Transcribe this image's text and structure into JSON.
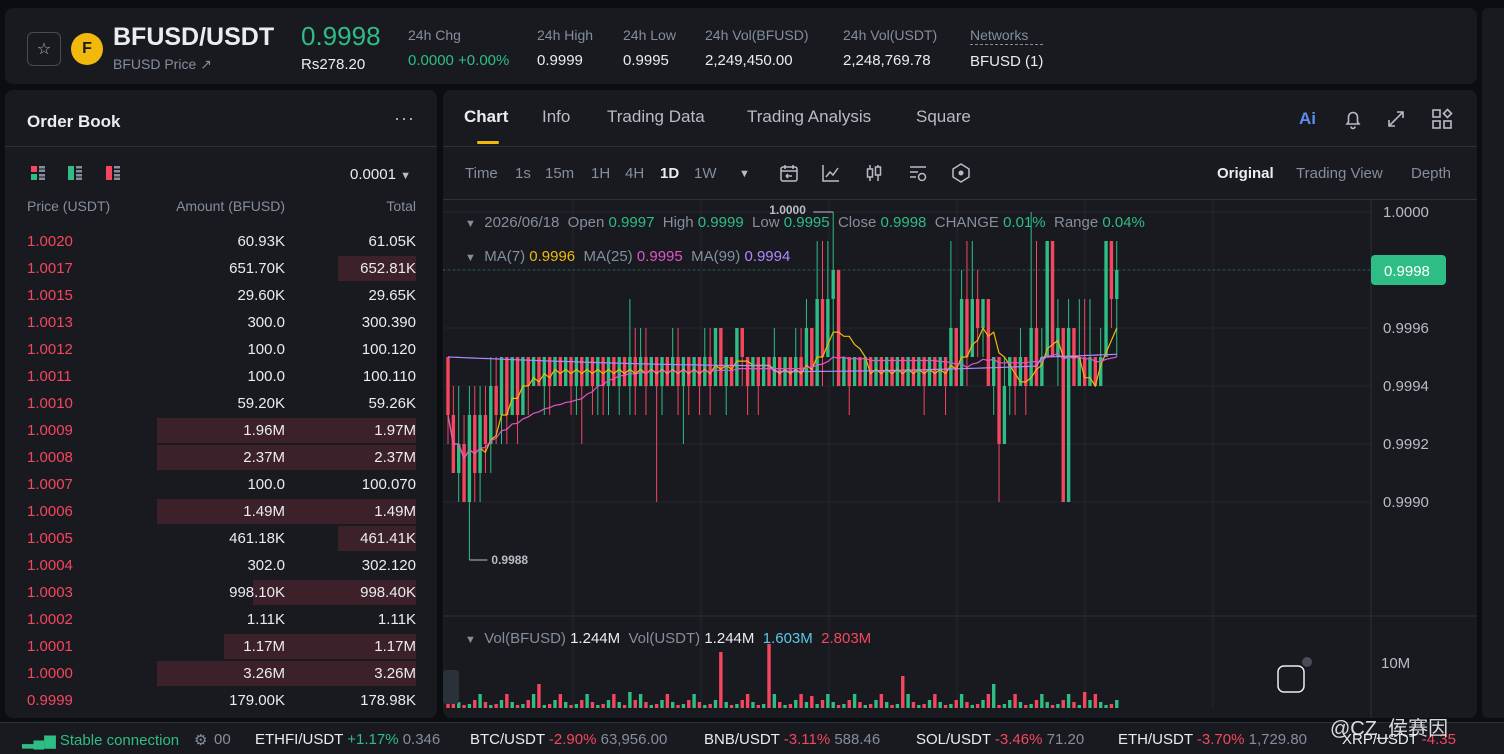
{
  "header": {
    "pair": "BFUSD/USDT",
    "sub": "BFUSD Price ↗",
    "last_price": "0.9998",
    "last_price_local": "Rs278.20",
    "stats": [
      {
        "label": "24h Chg",
        "value": "0.0000 +0.00%",
        "color": "#2ebd85"
      },
      {
        "label": "24h High",
        "value": "0.9999"
      },
      {
        "label": "24h Low",
        "value": "0.9995"
      },
      {
        "label": "24h Vol(BFUSD)",
        "value": "2,249,450.00"
      },
      {
        "label": "24h Vol(USDT)",
        "value": "2,248,769.78"
      },
      {
        "label": "Networks",
        "value": "BFUSD (1)"
      }
    ]
  },
  "orderbook": {
    "title": "Order Book",
    "precision": "0.0001",
    "col_price": "Price (USDT)",
    "col_amount": "Amount (BFUSD)",
    "col_total": "Total",
    "asks": [
      {
        "price": "1.0020",
        "amount": "60.93K",
        "total": "61.05K",
        "depth": 0.0
      },
      {
        "price": "1.0017",
        "amount": "651.70K",
        "total": "652.81K",
        "depth": 0.3
      },
      {
        "price": "1.0015",
        "amount": "29.60K",
        "total": "29.65K",
        "depth": 0.0
      },
      {
        "price": "1.0013",
        "amount": "300.0",
        "total": "300.390",
        "depth": 0.0
      },
      {
        "price": "1.0012",
        "amount": "100.0",
        "total": "100.120",
        "depth": 0.0
      },
      {
        "price": "1.0011",
        "amount": "100.0",
        "total": "100.110",
        "depth": 0.0
      },
      {
        "price": "1.0010",
        "amount": "59.20K",
        "total": "59.26K",
        "depth": 0.0
      },
      {
        "price": "1.0009",
        "amount": "1.96M",
        "total": "1.97M",
        "depth": 1.0
      },
      {
        "price": "1.0008",
        "amount": "2.37M",
        "total": "2.37M",
        "depth": 1.0
      },
      {
        "price": "1.0007",
        "amount": "100.0",
        "total": "100.070",
        "depth": 0.0
      },
      {
        "price": "1.0006",
        "amount": "1.49M",
        "total": "1.49M",
        "depth": 1.0
      },
      {
        "price": "1.0005",
        "amount": "461.18K",
        "total": "461.41K",
        "depth": 0.3
      },
      {
        "price": "1.0004",
        "amount": "302.0",
        "total": "302.120",
        "depth": 0.0
      },
      {
        "price": "1.0003",
        "amount": "998.10K",
        "total": "998.40K",
        "depth": 0.63
      },
      {
        "price": "1.0002",
        "amount": "1.11K",
        "total": "1.11K",
        "depth": 0.0
      },
      {
        "price": "1.0001",
        "amount": "1.17M",
        "total": "1.17M",
        "depth": 0.74
      },
      {
        "price": "1.0000",
        "amount": "3.26M",
        "total": "3.26M",
        "depth": 1.0
      },
      {
        "price": "0.9999",
        "amount": "179.00K",
        "total": "178.98K",
        "depth": 0.0
      }
    ]
  },
  "chart_tabs": [
    "Chart",
    "Info",
    "Trading Data",
    "Trading Analysis",
    "Square"
  ],
  "ai_label": "Ai",
  "intervals": [
    "Time",
    "1s",
    "15m",
    "1H",
    "4H",
    "1D",
    "1W"
  ],
  "active_interval": "1D",
  "views": [
    "Original",
    "Trading View",
    "Depth"
  ],
  "ohlc": {
    "date": "2026/06/18",
    "open_label": "Open",
    "open": "0.9997",
    "high_label": "High",
    "high": "0.9999",
    "low_label": "Low",
    "low": "0.9995",
    "close_label": "Close",
    "close": "0.9998",
    "change_label": "CHANGE",
    "change": "0.01%",
    "range_label": "Range",
    "range": "0.04%"
  },
  "ma": {
    "ma7_label": "MA(7)",
    "ma7": "0.9996",
    "ma25_label": "MA(25)",
    "ma25": "0.9995",
    "ma99_label": "MA(99)",
    "ma99": "0.9994"
  },
  "vol": {
    "label1": "Vol(BFUSD)",
    "v1": "1.244M",
    "label2": "Vol(USDT)",
    "v2": "1.244M",
    "v3": "1.603M",
    "v4": "2.803M",
    "axis_label": "10M"
  },
  "chart_data": {
    "type": "candlestick",
    "y_ticks": [
      "1.0000",
      "0.9996",
      "0.9994",
      "0.9992",
      "0.9990"
    ],
    "last_price_tag": "0.9998",
    "max_label": "1.0000",
    "min_label": "0.9988",
    "candles": [
      [
        0.9995,
        0.9993,
        0.9995,
        0.9992
      ],
      [
        0.9993,
        0.9991,
        0.9994,
        0.9991
      ],
      [
        0.9991,
        0.9992,
        0.9994,
        0.999
      ],
      [
        0.9992,
        0.999,
        0.9993,
        0.999
      ],
      [
        0.999,
        0.9993,
        0.9994,
        0.9988
      ],
      [
        0.9993,
        0.9991,
        0.9994,
        0.999
      ],
      [
        0.9991,
        0.9993,
        0.9994,
        0.999
      ],
      [
        0.9993,
        0.9992,
        0.9994,
        0.9991
      ],
      [
        0.9992,
        0.9994,
        0.9995,
        0.9991
      ],
      [
        0.9994,
        0.9993,
        0.9995,
        0.9992
      ],
      [
        0.9993,
        0.9995,
        0.9995,
        0.9992
      ],
      [
        0.9995,
        0.9993,
        0.9995,
        0.9992
      ],
      [
        0.9993,
        0.9995,
        0.9995,
        0.9993
      ],
      [
        0.9995,
        0.9993,
        0.9995,
        0.9992
      ],
      [
        0.9993,
        0.9995,
        0.9995,
        0.9993
      ],
      [
        0.9995,
        0.9994,
        0.9995,
        0.9993
      ],
      [
        0.9994,
        0.9995,
        0.9995,
        0.9994
      ],
      [
        0.9995,
        0.9994,
        0.9995,
        0.9994
      ],
      [
        0.9994,
        0.9995,
        0.9995,
        0.9993
      ],
      [
        0.9995,
        0.9994,
        0.9995,
        0.9993
      ],
      [
        0.9994,
        0.9995,
        0.9995,
        0.9994
      ],
      [
        0.9995,
        0.9994,
        0.9995,
        0.9994
      ],
      [
        0.9994,
        0.9995,
        0.9995,
        0.9994
      ],
      [
        0.9995,
        0.9994,
        0.9995,
        0.9993
      ],
      [
        0.9994,
        0.9995,
        0.9995,
        0.9993
      ],
      [
        0.9995,
        0.9994,
        0.9995,
        0.9992
      ],
      [
        0.9994,
        0.9995,
        0.9995,
        0.9994
      ],
      [
        0.9995,
        0.9994,
        0.9995,
        0.9993
      ],
      [
        0.9994,
        0.9995,
        0.9995,
        0.9993
      ],
      [
        0.9995,
        0.9994,
        0.9995,
        0.9993
      ],
      [
        0.9994,
        0.9995,
        0.9995,
        0.9993
      ],
      [
        0.9995,
        0.9994,
        0.9995,
        0.9994
      ],
      [
        0.9994,
        0.9995,
        0.9995,
        0.9993
      ],
      [
        0.9995,
        0.9994,
        0.9995,
        0.9994
      ],
      [
        0.9994,
        0.9995,
        0.9997,
        0.9993
      ],
      [
        0.9995,
        0.9994,
        0.9996,
        0.9993
      ],
      [
        0.9994,
        0.9995,
        0.9996,
        0.9994
      ],
      [
        0.9995,
        0.9994,
        0.9996,
        0.9993
      ],
      [
        0.9994,
        0.9995,
        0.9995,
        0.9994
      ],
      [
        0.9995,
        0.9994,
        0.9995,
        0.999
      ],
      [
        0.9994,
        0.9995,
        0.9995,
        0.9993
      ],
      [
        0.9995,
        0.9994,
        0.9995,
        0.9994
      ],
      [
        0.9994,
        0.9995,
        0.9996,
        0.9994
      ],
      [
        0.9995,
        0.9994,
        0.9996,
        0.9993
      ],
      [
        0.9994,
        0.9995,
        0.9995,
        0.9992
      ],
      [
        0.9995,
        0.9994,
        0.9995,
        0.9993
      ],
      [
        0.9994,
        0.9995,
        0.9995,
        0.9994
      ],
      [
        0.9995,
        0.9994,
        0.9995,
        0.9993
      ],
      [
        0.9994,
        0.9995,
        0.9996,
        0.9994
      ],
      [
        0.9995,
        0.9994,
        0.9996,
        0.9993
      ],
      [
        0.9994,
        0.9996,
        0.9996,
        0.9994
      ],
      [
        0.9996,
        0.9994,
        0.9996,
        0.9994
      ],
      [
        0.9994,
        0.9995,
        0.9995,
        0.9993
      ],
      [
        0.9995,
        0.9994,
        0.9995,
        0.9994
      ],
      [
        0.9994,
        0.9996,
        0.9996,
        0.9994
      ],
      [
        0.9996,
        0.9995,
        0.9996,
        0.9994
      ],
      [
        0.9995,
        0.9994,
        0.9995,
        0.9993
      ],
      [
        0.9994,
        0.9995,
        0.9995,
        0.9994
      ],
      [
        0.9995,
        0.9994,
        0.9995,
        0.9993
      ],
      [
        0.9994,
        0.9995,
        0.9995,
        0.9994
      ],
      [
        0.9995,
        0.9994,
        0.9995,
        0.9994
      ],
      [
        0.9994,
        0.9995,
        0.9996,
        0.9994
      ],
      [
        0.9995,
        0.9994,
        0.9995,
        0.9994
      ],
      [
        0.9994,
        0.9995,
        0.9995,
        0.9994
      ],
      [
        0.9995,
        0.9994,
        0.9995,
        0.9994
      ],
      [
        0.9994,
        0.9995,
        0.9996,
        0.9994
      ],
      [
        0.9995,
        0.9994,
        0.9996,
        0.9994
      ],
      [
        0.9994,
        0.9996,
        0.9997,
        0.9994
      ],
      [
        0.9996,
        0.9994,
        0.9996,
        0.9994
      ],
      [
        0.9994,
        0.9997,
        0.9999,
        0.9994
      ],
      [
        0.9997,
        0.9995,
        0.9999,
        0.9994
      ],
      [
        0.9995,
        0.9997,
        0.9999,
        0.9995
      ],
      [
        0.9997,
        0.9998,
        1.0,
        0.9994
      ],
      [
        0.9998,
        0.9994,
        0.9998,
        0.9994
      ],
      [
        0.9994,
        0.9995,
        0.9995,
        0.9994
      ],
      [
        0.9995,
        0.9994,
        0.9995,
        0.9993
      ],
      [
        0.9994,
        0.9995,
        0.9995,
        0.9994
      ],
      [
        0.9995,
        0.9994,
        0.9995,
        0.9994
      ],
      [
        0.9994,
        0.9995,
        0.9995,
        0.9994
      ],
      [
        0.9995,
        0.9994,
        0.9995,
        0.9994
      ],
      [
        0.9994,
        0.9995,
        0.9995,
        0.9994
      ],
      [
        0.9995,
        0.9994,
        0.9995,
        0.9994
      ],
      [
        0.9994,
        0.9995,
        0.9995,
        0.9994
      ],
      [
        0.9995,
        0.9994,
        0.9995,
        0.9994
      ],
      [
        0.9994,
        0.9995,
        0.9995,
        0.9994
      ],
      [
        0.9995,
        0.9994,
        0.9995,
        0.9994
      ],
      [
        0.9994,
        0.9995,
        0.9995,
        0.9994
      ],
      [
        0.9995,
        0.9994,
        0.9995,
        0.9994
      ],
      [
        0.9994,
        0.9995,
        0.9995,
        0.9994
      ],
      [
        0.9995,
        0.9994,
        0.9995,
        0.9993
      ],
      [
        0.9994,
        0.9995,
        0.9995,
        0.9994
      ],
      [
        0.9995,
        0.9994,
        0.9995,
        0.9994
      ],
      [
        0.9994,
        0.9995,
        0.9995,
        0.9994
      ],
      [
        0.9995,
        0.9994,
        0.9995,
        0.9993
      ],
      [
        0.9994,
        0.9996,
        0.9999,
        0.9994
      ],
      [
        0.9996,
        0.9994,
        0.9996,
        0.9994
      ],
      [
        0.9994,
        0.9997,
        0.9998,
        0.9994
      ],
      [
        0.9997,
        0.9995,
        0.9999,
        0.9994
      ],
      [
        0.9995,
        0.9997,
        0.9999,
        0.9995
      ],
      [
        0.9997,
        0.9996,
        0.9998,
        0.9995
      ],
      [
        0.9996,
        0.9997,
        0.9997,
        0.9995
      ],
      [
        0.9997,
        0.9994,
        0.9997,
        0.9994
      ],
      [
        0.9994,
        0.9995,
        0.9995,
        0.9993
      ],
      [
        0.9995,
        0.9992,
        0.9995,
        0.999
      ],
      [
        0.9992,
        0.9994,
        0.9995,
        0.9992
      ],
      [
        0.9994,
        0.9995,
        0.9995,
        0.9993
      ],
      [
        0.9995,
        0.9994,
        0.9995,
        0.9993
      ],
      [
        0.9994,
        0.9995,
        0.9996,
        0.9994
      ],
      [
        0.9995,
        0.9994,
        0.9995,
        0.9993
      ],
      [
        0.9994,
        0.9996,
        1.0,
        0.9994
      ],
      [
        0.9996,
        0.9994,
        0.9999,
        0.9994
      ],
      [
        0.9994,
        0.9995,
        0.9996,
        0.9994
      ],
      [
        0.9995,
        0.9999,
        0.9999,
        0.9995
      ],
      [
        0.9999,
        0.9995,
        0.9999,
        0.9995
      ],
      [
        0.9995,
        0.9996,
        0.9997,
        0.9994
      ],
      [
        0.9996,
        0.999,
        0.9996,
        0.999
      ],
      [
        0.999,
        0.9996,
        0.9997,
        0.999
      ],
      [
        0.9996,
        0.9994,
        0.9996,
        0.9994
      ],
      [
        0.9994,
        0.9995,
        0.9997,
        0.9994
      ],
      [
        0.9995,
        0.9994,
        0.9997,
        0.9994
      ],
      [
        0.9994,
        0.9995,
        0.9997,
        0.9994
      ],
      [
        0.9995,
        0.9994,
        0.9995,
        0.9994
      ],
      [
        0.9994,
        0.9995,
        0.9996,
        0.9994
      ],
      [
        0.9995,
        0.9999,
        0.9999,
        0.9995
      ],
      [
        0.9999,
        0.9997,
        0.9999,
        0.9996
      ],
      [
        0.9997,
        0.9998,
        0.9999,
        0.9995
      ]
    ]
  },
  "bottom": {
    "connection": "Stable connection",
    "tickers": [
      {
        "pair": "ETHFI/USDT",
        "chg": "+1.17%",
        "price": "0.346",
        "up": true
      },
      {
        "pair": "BTC/USDT",
        "chg": "-2.90%",
        "price": "63,956.00",
        "up": false
      },
      {
        "pair": "BNB/USDT",
        "chg": "-3.11%",
        "price": "588.46",
        "up": false
      },
      {
        "pair": "SOL/USDT",
        "chg": "-3.46%",
        "price": "71.20",
        "up": false
      },
      {
        "pair": "ETH/USDT",
        "chg": "-3.70%",
        "price": "1,729.80",
        "up": false
      },
      {
        "pair": "XRP/USDT",
        "chg": "-4.35",
        "price": "",
        "up": false
      }
    ],
    "partial": "00"
  },
  "watermark": "@CZ_侯赛因",
  "colors": {
    "up": "#2ebd85",
    "down": "#f6465d",
    "accent": "#f0b90b",
    "ma7": "#f0b90b",
    "ma25": "#e056c8",
    "ma99": "#b388ff"
  }
}
